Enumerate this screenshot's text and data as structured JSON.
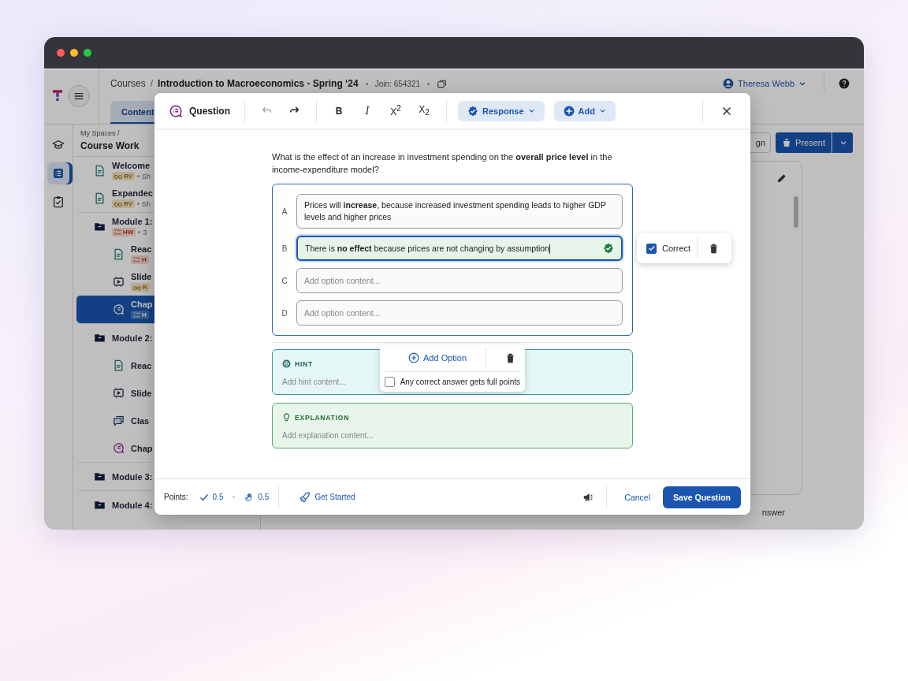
{
  "header": {
    "breadcrumb_root": "Courses",
    "separator": "/",
    "course": "Introduction to Macroeconomics - Spring ‘24",
    "join": "Join: 654321",
    "user": "Theresa Webb",
    "tab": {
      "label": "Content",
      "selected": true
    }
  },
  "rail": [
    {
      "kind": "cap",
      "selected": false
    },
    {
      "kind": "list",
      "selected": true
    },
    {
      "kind": "clipboard",
      "selected": false
    }
  ],
  "sidebar": {
    "path": "My Spaces /",
    "title": "Course Work",
    "items": [
      {
        "kind": "reading",
        "title": "Welcome",
        "badge": {
          "kind": "rv",
          "label": "RV"
        },
        "meta": "Sh",
        "selected": false
      },
      {
        "kind": "reading",
        "title": "Expandec",
        "badge": {
          "kind": "rv",
          "label": "RV"
        },
        "meta": "Sh",
        "selected": false
      },
      {
        "kind": "module",
        "title": "Module 1:",
        "badge": {
          "kind": "hw",
          "label": "HW"
        },
        "meta": "3",
        "selected": false,
        "children": [
          {
            "kind": "reading",
            "title": "Reac",
            "badge": {
              "kind": "hw",
              "label": "H"
            },
            "selected": false
          },
          {
            "kind": "slides",
            "title": "Slide",
            "badge": {
              "kind": "rv",
              "label": "R"
            },
            "selected": false
          },
          {
            "kind": "quiz",
            "title": "Chap",
            "badge": {
              "kind": "hw",
              "label": "H"
            },
            "selected": true
          }
        ]
      },
      {
        "kind": "module",
        "title": "Module 2:",
        "selected": false,
        "children": [
          {
            "kind": "reading",
            "title": "Reac",
            "selected": false
          },
          {
            "kind": "slides",
            "title": "Slide",
            "selected": false
          },
          {
            "kind": "discussion",
            "title": "Clas",
            "selected": false
          },
          {
            "kind": "quiz",
            "title": "Chap",
            "selected": false
          }
        ]
      },
      {
        "kind": "module",
        "title": "Module 3:",
        "selected": false
      },
      {
        "kind": "module",
        "title": "Module 4:",
        "selected": false
      }
    ]
  },
  "main": {
    "assign_fragment": "gn",
    "present": "Present",
    "answer_fragment": "nswer"
  },
  "modal": {
    "title": "Question",
    "undo": {
      "disabled": true
    },
    "redo": {
      "disabled": false
    },
    "format": [
      "B",
      "I",
      "X$^{2}$",
      "X$_{2}$"
    ],
    "response": "Response",
    "add": "Add",
    "question": "What is the effect of an increase in investment spending on the **overall price level** in the income-expenditure model?",
    "options": [
      {
        "letter": "A",
        "text": "Prices will **increase**, because increased investment spending leads to higher GDP levels and higher prices",
        "correct": false,
        "focused": false
      },
      {
        "letter": "B",
        "text": "There is **no effect** because prices are not changing by assumption",
        "correct": true,
        "focused": true
      },
      {
        "letter": "C",
        "placeholder": "Add option content...",
        "correct": false,
        "focused": false
      },
      {
        "letter": "D",
        "placeholder": "Add option content...",
        "correct": false,
        "focused": false
      }
    ],
    "option_menu": {
      "label": "Correct",
      "checked": true
    },
    "add_menu": {
      "add_option": "Add Option",
      "full_points": {
        "label": "Any correct answer gets full points",
        "checked": false
      }
    },
    "hint": {
      "label": "HINT",
      "placeholder": "Add hint content..."
    },
    "explanation": {
      "label": "EXPLANATION",
      "placeholder": "Add explanation content..."
    },
    "footer": {
      "points_label": "Points:",
      "points": [
        {
          "kind": "check",
          "value": "0.5"
        },
        {
          "kind": "hands",
          "value": "0.5"
        }
      ],
      "get_started": "Get Started",
      "cancel": "Cancel",
      "save": "Save Question"
    }
  }
}
